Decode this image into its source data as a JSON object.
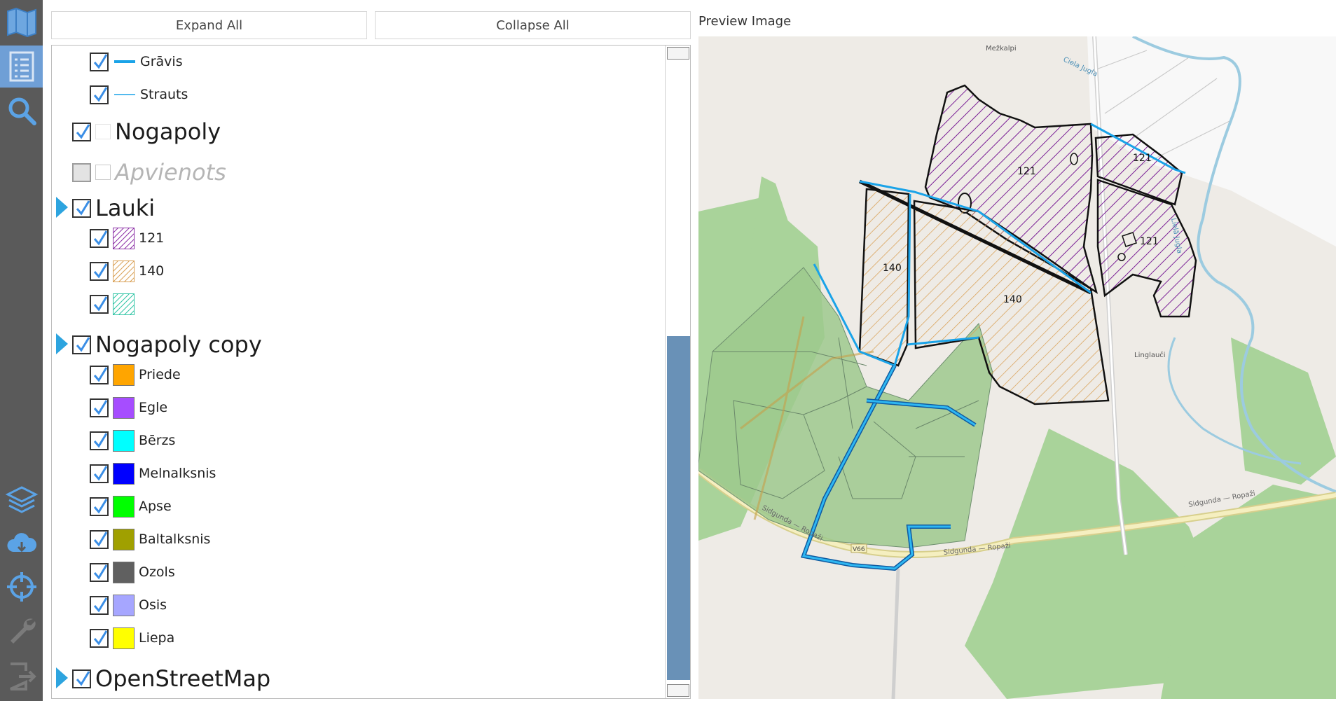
{
  "toolbar": {
    "items": [
      {
        "icon": "map-icon"
      },
      {
        "icon": "document-list-icon",
        "active": true
      },
      {
        "icon": "search-icon"
      },
      {
        "icon": "layers-icon"
      },
      {
        "icon": "cloud-icon"
      },
      {
        "icon": "crosshair-icon"
      },
      {
        "icon": "wrench-icon"
      },
      {
        "icon": "exit-icon"
      }
    ]
  },
  "layer_panel": {
    "expand_all_label": "Expand All",
    "collapse_all_label": "Collapse All",
    "items": {
      "gravis": {
        "label": "Grāvis",
        "checked": true,
        "symbol": "line-thick",
        "color": "#1aa3e8"
      },
      "strauts": {
        "label": "Strauts",
        "checked": true,
        "symbol": "line-thin",
        "color": "#1aa3e8"
      },
      "nogapoly": {
        "label": "Nogapoly",
        "checked": true
      },
      "apvienots": {
        "label": "Apvienots",
        "checked": false,
        "disabled": true
      },
      "lauki": {
        "label": "Lauki",
        "checked": true,
        "expandable": true
      },
      "lauki_121": {
        "label": "121",
        "checked": true,
        "hatch_color": "#8b2fa5"
      },
      "lauki_140": {
        "label": "140",
        "checked": true,
        "hatch_color": "#d9a055"
      },
      "lauki_blank": {
        "label": "",
        "checked": true,
        "hatch_color": "#2ec4a4"
      },
      "nogapoly_copy": {
        "label": "Nogapoly copy",
        "checked": true,
        "expandable": true
      },
      "priede": {
        "label": "Priede",
        "checked": true,
        "color": "#ffa500"
      },
      "egle": {
        "label": "Egle",
        "checked": true,
        "color": "#a64dff"
      },
      "berzs": {
        "label": "Bērzs",
        "checked": true,
        "color": "#00ffff"
      },
      "melnalksnis": {
        "label": "Melnalksnis",
        "checked": true,
        "color": "#0000ff"
      },
      "apse": {
        "label": "Apse",
        "checked": true,
        "color": "#00ff00"
      },
      "baltalksnis": {
        "label": "Baltalksnis",
        "checked": true,
        "color": "#a0a000"
      },
      "ozols": {
        "label": "Ozols",
        "checked": true,
        "color": "#606060"
      },
      "osis": {
        "label": "Osis",
        "checked": true,
        "color": "#a6a6ff"
      },
      "liepa": {
        "label": "Liepa",
        "checked": true,
        "color": "#ffff00"
      },
      "openstreetmap": {
        "label": "OpenStreetMap",
        "checked": true,
        "expandable": true
      }
    }
  },
  "preview": {
    "title": "Preview Image",
    "map_labels": {
      "place_mezkalpi": "Mežkalpi",
      "place_linglauci": "Linglauči",
      "road_sidgunda_1": "Sidgunda — Ropaži",
      "road_sidgunda_2": "Sidgunda — Ropaži",
      "road_sidgunda_3": "Sidgunda — Ropaži",
      "road_v66": "V66",
      "river_1": "Ciela Jugla",
      "river_2": "Lielā Jugla"
    },
    "parcels": {
      "p121a": "121",
      "p121b": "121",
      "p121c": "121",
      "p140a": "140",
      "p140b": "140"
    }
  }
}
